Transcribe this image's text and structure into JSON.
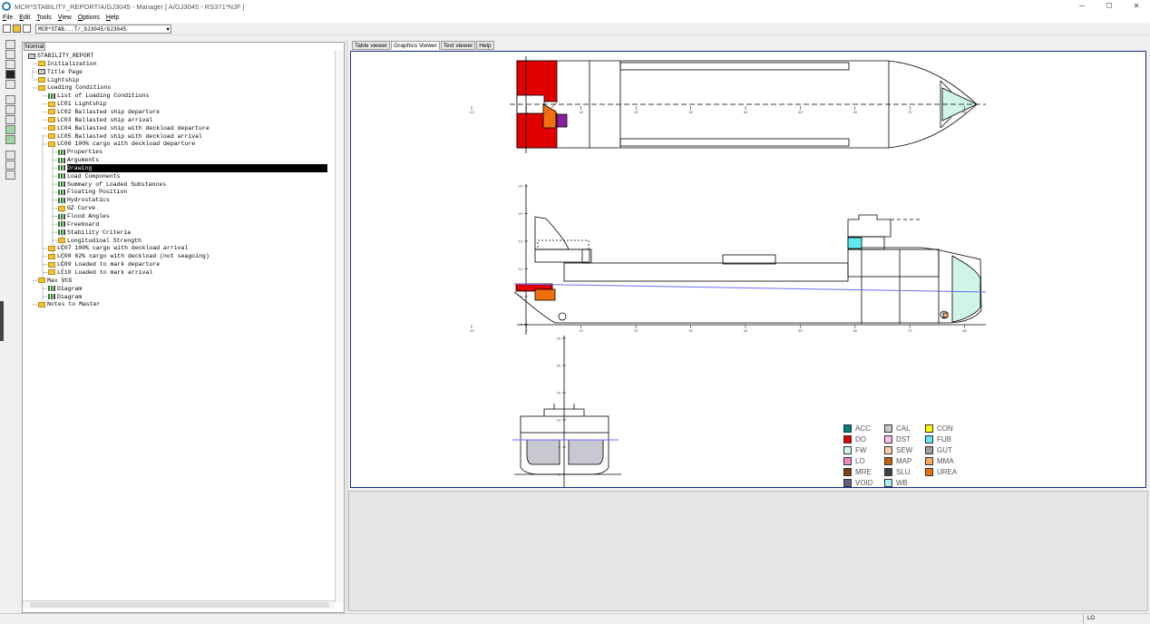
{
  "window": {
    "title": "MCR*STABILITY_REPORT/A/GJ3045 - Manager [ A/GJ3045 - RS371*NJF ]",
    "minimize": "─",
    "maximize": "☐",
    "close": "✕"
  },
  "menu": [
    "File",
    "Edit",
    "Tools",
    "View",
    "Options",
    "Help"
  ],
  "toolbar": {
    "combo_value": "MCR*STAB...T/_9J3045/GJ3045"
  },
  "tree": {
    "tab": "Normal",
    "nodes": [
      {
        "label": "STABILITY_REPORT",
        "indent": 0,
        "icon": "doc"
      },
      {
        "label": "Initialization",
        "indent": 1,
        "icon": "folder"
      },
      {
        "label": "Title Page",
        "indent": 1,
        "icon": "doc"
      },
      {
        "label": "Lightship",
        "indent": 1,
        "icon": "folder"
      },
      {
        "label": "Loading Conditions",
        "indent": 1,
        "icon": "folder"
      },
      {
        "label": "List of Loading Conditions",
        "indent": 2,
        "icon": "bars"
      },
      {
        "label": "LC01 Lightship",
        "indent": 2,
        "icon": "folder"
      },
      {
        "label": "LC02 Ballasted ship departure",
        "indent": 2,
        "icon": "folder"
      },
      {
        "label": "LC03 Ballasted ship arrival",
        "indent": 2,
        "icon": "folder"
      },
      {
        "label": "LC04 Ballasted ship with deckload departure",
        "indent": 2,
        "icon": "folder"
      },
      {
        "label": "LC05 Ballasted ship with deckload arrival",
        "indent": 2,
        "icon": "folder"
      },
      {
        "label": "LC06 100% cargo with deckload departure",
        "indent": 2,
        "icon": "folder"
      },
      {
        "label": "Properties",
        "indent": 3,
        "icon": "bars"
      },
      {
        "label": "Arguments",
        "indent": 3,
        "icon": "bars"
      },
      {
        "label": "Drawing",
        "indent": 3,
        "icon": "bars",
        "selected": true
      },
      {
        "label": "Load Components",
        "indent": 3,
        "icon": "bars"
      },
      {
        "label": "Summary of Loaded Substances",
        "indent": 3,
        "icon": "bars"
      },
      {
        "label": "Floating Position",
        "indent": 3,
        "icon": "bars"
      },
      {
        "label": "Hydrostatics",
        "indent": 3,
        "icon": "bars"
      },
      {
        "label": "GZ Curve",
        "indent": 3,
        "icon": "folder"
      },
      {
        "label": "Flood Angles",
        "indent": 3,
        "icon": "bars"
      },
      {
        "label": "Freeboard",
        "indent": 3,
        "icon": "bars"
      },
      {
        "label": "Stability Criteria",
        "indent": 3,
        "icon": "bars"
      },
      {
        "label": "Longitudinal Strength",
        "indent": 3,
        "icon": "folder"
      },
      {
        "label": "LC07 100% cargo with deckload arrival",
        "indent": 2,
        "icon": "folder"
      },
      {
        "label": "LC08 62% cargo with deckload (not seagoing)",
        "indent": 2,
        "icon": "folder"
      },
      {
        "label": "LC09 Loaded to mark departure",
        "indent": 2,
        "icon": "folder"
      },
      {
        "label": "LC10 Loaded to mark arrival",
        "indent": 2,
        "icon": "folder"
      },
      {
        "label": "Max VCG",
        "indent": 1,
        "icon": "folder"
      },
      {
        "label": "Diagram",
        "indent": 2,
        "icon": "bars"
      },
      {
        "label": "Diagram",
        "indent": 2,
        "icon": "bars"
      },
      {
        "label": "Notes to Master",
        "indent": 1,
        "icon": "folder"
      }
    ]
  },
  "viewer_tabs": [
    {
      "label": "Table viewer",
      "active": false
    },
    {
      "label": "Graphics Viewer",
      "active": true
    },
    {
      "label": "Text viewer",
      "active": false
    },
    {
      "label": "Help",
      "active": false
    }
  ],
  "plan_ticks": [
    "-10",
    "0",
    "10",
    "20",
    "30",
    "40",
    "50",
    "60",
    "70",
    "80"
  ],
  "profile_ticks": [
    "-10",
    "0",
    "10",
    "20",
    "30",
    "40",
    "50",
    "60",
    "70",
    "80"
  ],
  "profile_vticks": [
    "25",
    "20",
    "15",
    "10",
    "5",
    "0"
  ],
  "section_vticks": [
    "25",
    "20",
    "15",
    "10",
    "5",
    "0"
  ],
  "legend": [
    {
      "code": "ACC",
      "color": "#008080"
    },
    {
      "code": "CAL",
      "color": "#c8c8c8"
    },
    {
      "code": "CON",
      "color": "#ffff00"
    },
    {
      "code": "DO",
      "color": "#e00000"
    },
    {
      "code": "DST",
      "color": "#f4c0e6"
    },
    {
      "code": "FUB",
      "color": "#60e8f0"
    },
    {
      "code": "FW",
      "color": "#d0f4e8"
    },
    {
      "code": "SEW",
      "color": "#f8cfa8"
    },
    {
      "code": "GUT",
      "color": "#a0a0a0"
    },
    {
      "code": "LO",
      "color": "#f088c0"
    },
    {
      "code": "MAP",
      "color": "#c06010"
    },
    {
      "code": "MMA",
      "color": "#f8a860"
    },
    {
      "code": "MRE",
      "color": "#804010"
    },
    {
      "code": "SLU",
      "color": "#404040"
    },
    {
      "code": "UREA",
      "color": "#f07010"
    },
    {
      "code": "VOID",
      "color": "#606080"
    },
    {
      "code": "WB",
      "color": "#a8f0f8"
    }
  ],
  "status": {
    "right_text": "LO"
  }
}
